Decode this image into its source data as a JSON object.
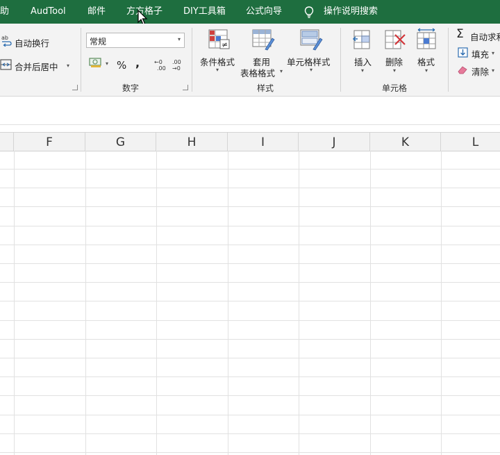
{
  "tabs": [
    "助",
    "AudTool",
    "邮件",
    "方方格子",
    "DIY工具箱",
    "公式向导"
  ],
  "tell_me": "操作说明搜索",
  "alignment": {
    "wrap_text": "自动换行",
    "merge_center": "合并后居中"
  },
  "number": {
    "format_value": "常规",
    "percent": "%",
    "comma": ",",
    "inc_decimal": "←0\n.00",
    "dec_decimal": ".00\n→0",
    "group_label": "数字"
  },
  "styles": {
    "conditional": "条件格式",
    "format_table_1": "套用",
    "format_table_2": "表格格式",
    "cell_styles": "单元格样式",
    "group_label": "样式"
  },
  "cells": {
    "insert": "插入",
    "delete": "删除",
    "format": "格式",
    "group_label": "单元格"
  },
  "editing": {
    "autosum": "自动求和",
    "fill": "填充",
    "clear": "清除"
  },
  "columns": [
    "F",
    "G",
    "H",
    "I",
    "J",
    "K",
    "L"
  ],
  "colors": {
    "tab_bar": "#1e6e3f",
    "ribbon": "#f3f3f3",
    "grid": "#e1e1e1"
  }
}
